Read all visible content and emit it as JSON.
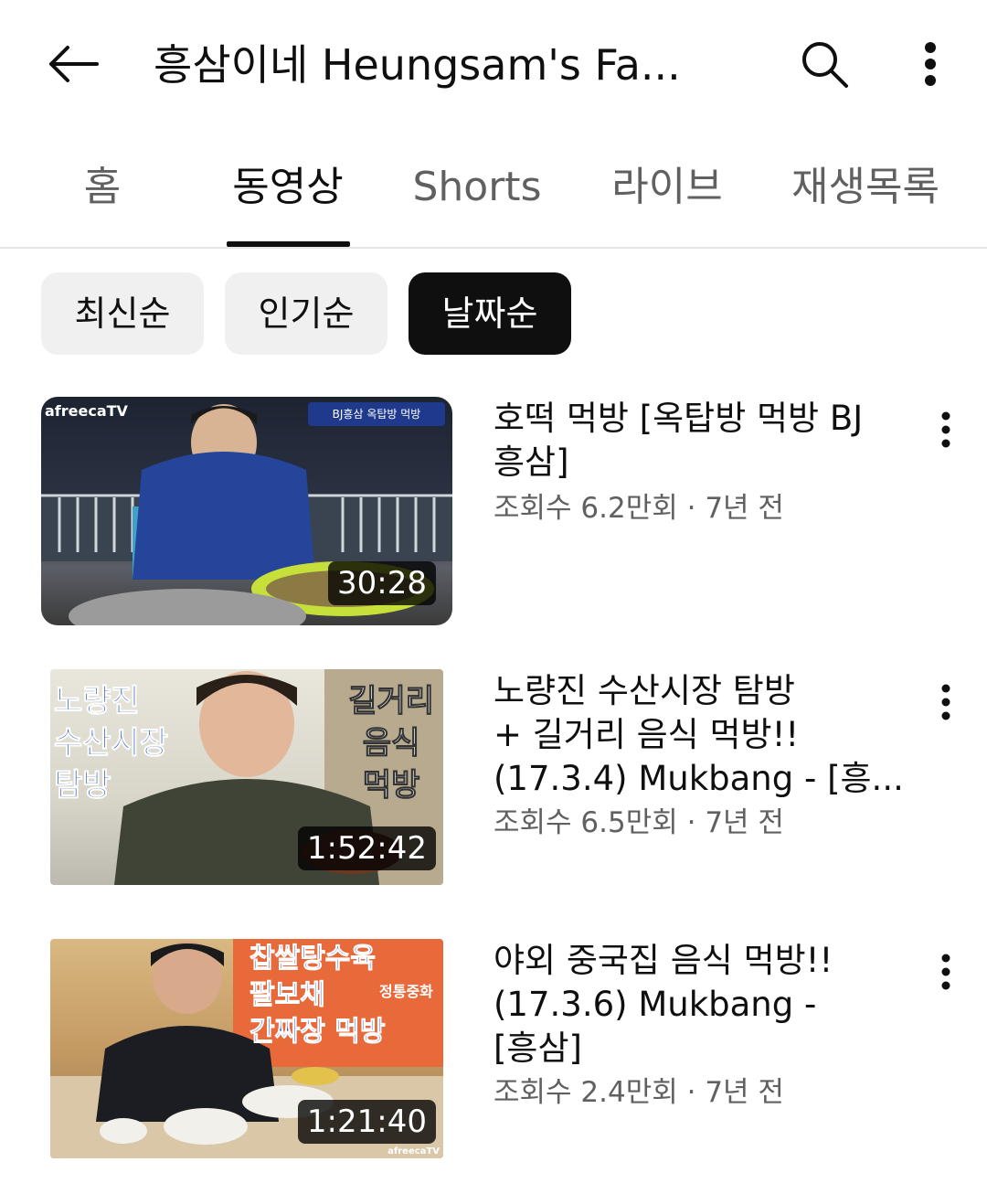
{
  "header": {
    "title": "흥삼이네 Heungsam's Fa..."
  },
  "tabs": [
    {
      "label": "홈"
    },
    {
      "label": "동영상"
    },
    {
      "label": "Shorts"
    },
    {
      "label": "라이브"
    },
    {
      "label": "재생목록"
    }
  ],
  "active_tab": "동영상",
  "chips": [
    {
      "label": "최신순"
    },
    {
      "label": "인기순"
    },
    {
      "label": "날짜순"
    }
  ],
  "active_chip": "날짜순",
  "videos": [
    {
      "title_lines": [
        "호떡 먹방 [옥탑방 먹방 BJ",
        "흥삼]"
      ],
      "meta": "조회수 6.2만회 · 7년 전",
      "duration": "30:28",
      "thumb_text": {
        "logo": "afreecaTV",
        "banner": "BJ흥삼 옥탑방 먹방"
      }
    },
    {
      "title_lines": [
        "노량진 수산시장 탐방",
        "+ 길거리 음식 먹방!!",
        "(17.3.4) Mukbang - [흥..."
      ],
      "meta": "조회수 6.5만회 · 7년 전",
      "duration": "1:52:42",
      "thumb_text": {
        "left": [
          "노량진",
          "수산시장",
          "탐방"
        ],
        "right": [
          "길거리",
          "음식",
          "먹방"
        ]
      }
    },
    {
      "title_lines": [
        "야외 중국집 음식 먹방!!",
        "(17.3.6) Mukbang -",
        "[흥삼]"
      ],
      "meta": "조회수 2.4만회 · 7년 전",
      "duration": "1:21:40",
      "thumb_text": {
        "lines": [
          "찹쌀탕수육",
          "팔보채",
          "간짜장 먹방"
        ],
        "sign": "정통중화",
        "logo": "afreecaTV"
      }
    }
  ],
  "colors": {
    "text_primary": "#0f0f0f",
    "text_secondary": "#606060",
    "chip_bg": "#f0f0f0",
    "chip_active_bg": "#0f0f0f"
  },
  "icons": {
    "back": "arrow-left-icon",
    "search": "search-icon",
    "more": "more-vertical-icon"
  }
}
